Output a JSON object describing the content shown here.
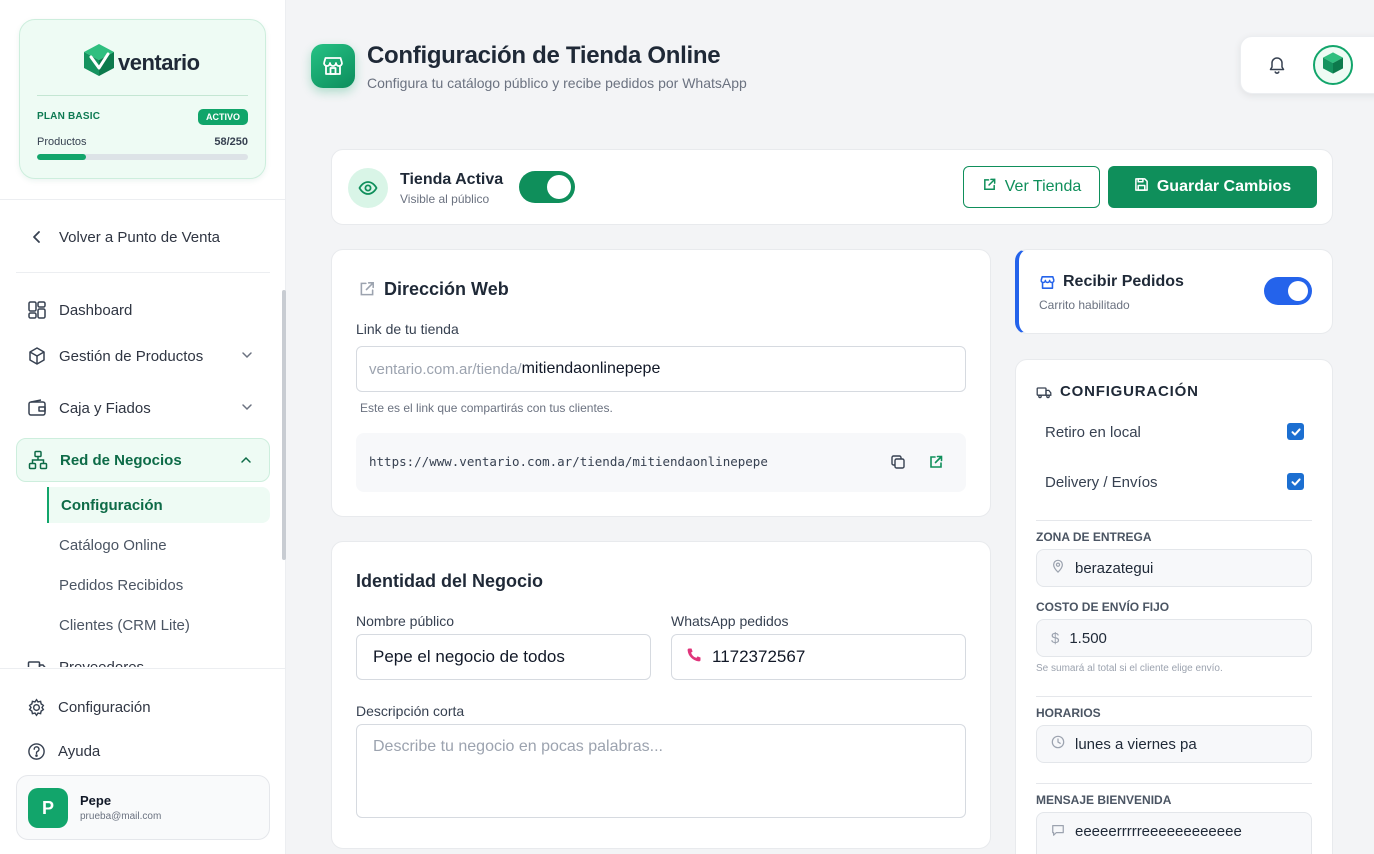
{
  "sidebar": {
    "brand": "ventario",
    "plan": {
      "name": "PLAN BASIC",
      "badge": "ACTIVO",
      "products_label": "Productos",
      "products_count": "58/250",
      "usage_fraction": 0.232
    },
    "back_label": "Volver a Punto de Venta",
    "nav": {
      "dashboard": "Dashboard",
      "productos": "Gestión de Productos",
      "caja": "Caja y Fiados",
      "red": "Red de Negocios",
      "proveedores": "Proveedores"
    },
    "sub": {
      "configuracion": "Configuración",
      "catalogo": "Catálogo Online",
      "pedidos": "Pedidos Recibidos",
      "clientes": "Clientes (CRM Lite)"
    },
    "bottom": {
      "configuracion": "Configuración",
      "ayuda": "Ayuda"
    },
    "user": {
      "initial": "P",
      "name": "Pepe",
      "email": "prueba@mail.com"
    }
  },
  "header": {
    "title": "Configuración de Tienda Online",
    "subtitle": "Configura tu catálogo público y recibe pedidos por WhatsApp"
  },
  "toolbar": {
    "store_active_title": "Tienda Activa",
    "store_active_sub": "Visible al público",
    "store_active_on": true,
    "view_store_label": "Ver Tienda",
    "save_label": "Guardar Cambios"
  },
  "web": {
    "title": "Dirección Web",
    "link_label": "Link de tu tienda",
    "prefix": "ventario.com.ar/tienda/",
    "slug": "mitiendaonlinepepe",
    "hint": "Este es el link que compartirás con tus clientes.",
    "full_url": "https://www.ventario.com.ar/tienda/mitiendaonlinepepe"
  },
  "identity": {
    "title": "Identidad del Negocio",
    "name_label": "Nombre público",
    "name_value": "Pepe el negocio de todos",
    "whatsapp_label": "WhatsApp pedidos",
    "whatsapp_value": "1172372567",
    "desc_label": "Descripción corta",
    "desc_placeholder": "Describe tu negocio en pocas palabras..."
  },
  "orders": {
    "title": "Recibir Pedidos",
    "sub": "Carrito habilitado",
    "enabled": true
  },
  "config": {
    "title": "CONFIGURACIÓN",
    "pickup_label": "Retiro en local",
    "pickup_checked": true,
    "delivery_label": "Delivery / Envíos",
    "delivery_checked": true,
    "zone_label": "ZONA DE ENTREGA",
    "zone_value": "berazategui",
    "cost_label": "COSTO DE ENVÍO FIJO",
    "cost_currency": "$",
    "cost_value": "1.500",
    "cost_hint": "Se sumará al total si el cliente elige envío.",
    "hours_label": "HORARIOS",
    "hours_value": "lunes a viernes pa",
    "welcome_label": "MENSAJE BIENVENIDA",
    "welcome_value": "eeeeerrrrreeeeeeeeeeee"
  },
  "colors": {
    "brand_green": "#0f8f5b",
    "accent_blue": "#2463eb",
    "badge_green": "#10a56a"
  }
}
